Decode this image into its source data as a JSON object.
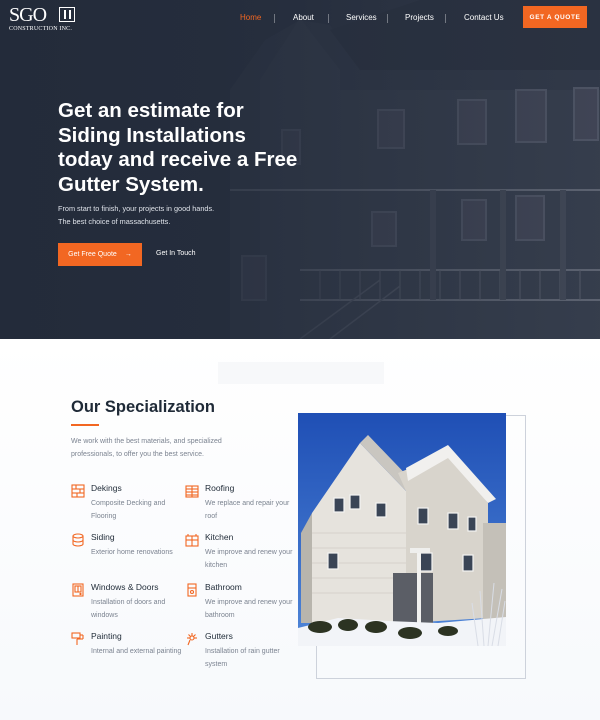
{
  "brand": {
    "logo_main": "SGO",
    "logo_sub": "CONSTRUCTION INC."
  },
  "nav": {
    "items": [
      {
        "label": "Home",
        "active": true
      },
      {
        "label": "About",
        "active": false
      },
      {
        "label": "Services",
        "active": false
      },
      {
        "label": "Projects",
        "active": false
      },
      {
        "label": "Contact Us",
        "active": false
      }
    ],
    "cta": "GET A QUOTE"
  },
  "hero": {
    "headline": "Get an estimate for Siding Installations today and receive a Free Gutter System.",
    "sub_line1": "From start to finish, your projects in good hands.",
    "sub_line2": "The best choice of massachusetts.",
    "primary_button": "Get Free Quote",
    "primary_arrow": "→",
    "secondary_button": "Get In Touch"
  },
  "specialization": {
    "title": "Our Specialization",
    "description": "We work with the best materials, and specialized professionals, to offer you the best service.",
    "items": [
      {
        "title": "Dekings",
        "desc": "Composite Decking and Flooring",
        "icon": "deck-icon"
      },
      {
        "title": "Roofing",
        "desc": "We replace and repair your roof",
        "icon": "roof-icon"
      },
      {
        "title": "Siding",
        "desc": "Exterior home renovations",
        "icon": "siding-icon"
      },
      {
        "title": "Kitchen",
        "desc": "We improve and renew your kitchen",
        "icon": "kitchen-icon"
      },
      {
        "title": "Windows & Doors",
        "desc": "Installation of doors and windows",
        "icon": "window-door-icon"
      },
      {
        "title": "Bathroom",
        "desc": "We improve and renew your bathroom",
        "icon": "bathroom-icon"
      },
      {
        "title": "Painting",
        "desc": "Internal and external painting",
        "icon": "paint-icon"
      },
      {
        "title": "Gutters",
        "desc": "Installation of rain gutter system",
        "icon": "gutter-icon"
      }
    ]
  },
  "colors": {
    "accent": "#f26722",
    "hero_overlay": "#2a3243",
    "text_dark": "#1f2a37",
    "text_muted": "#7b8390"
  }
}
